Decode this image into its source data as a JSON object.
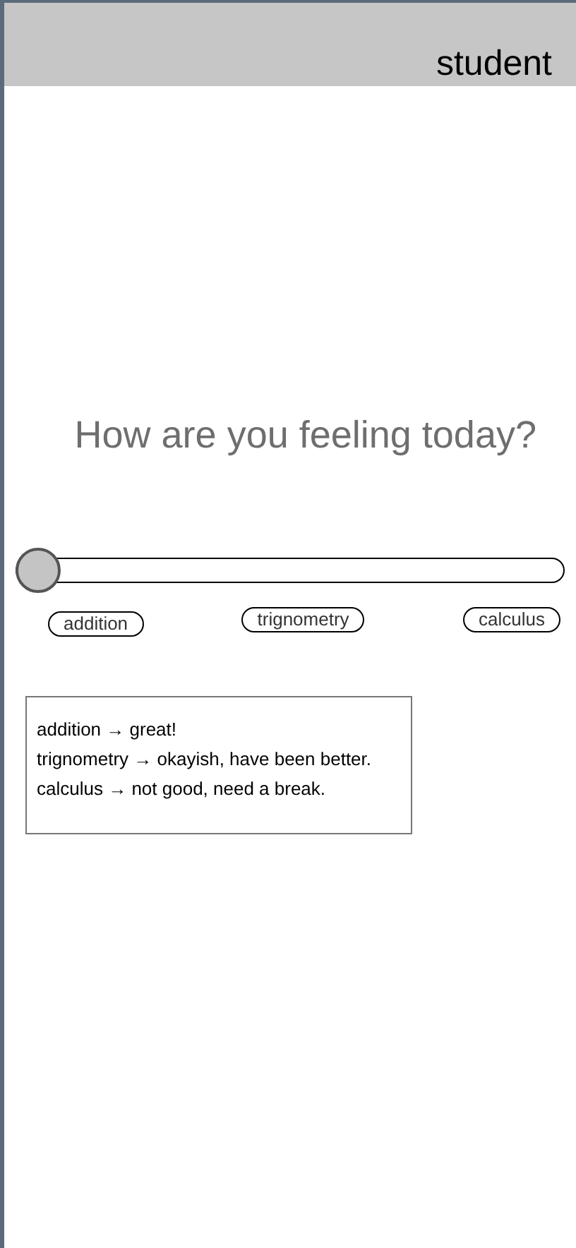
{
  "header": {
    "title": "student"
  },
  "question": "How are you feeling today?",
  "slider": {
    "level": 0
  },
  "slider_labels": [
    "addition",
    "trignometry",
    "calculus"
  ],
  "feelings": [
    "addition → great!",
    "trignometry → okayish, have been better.",
    "calculus → not good, need a break."
  ]
}
